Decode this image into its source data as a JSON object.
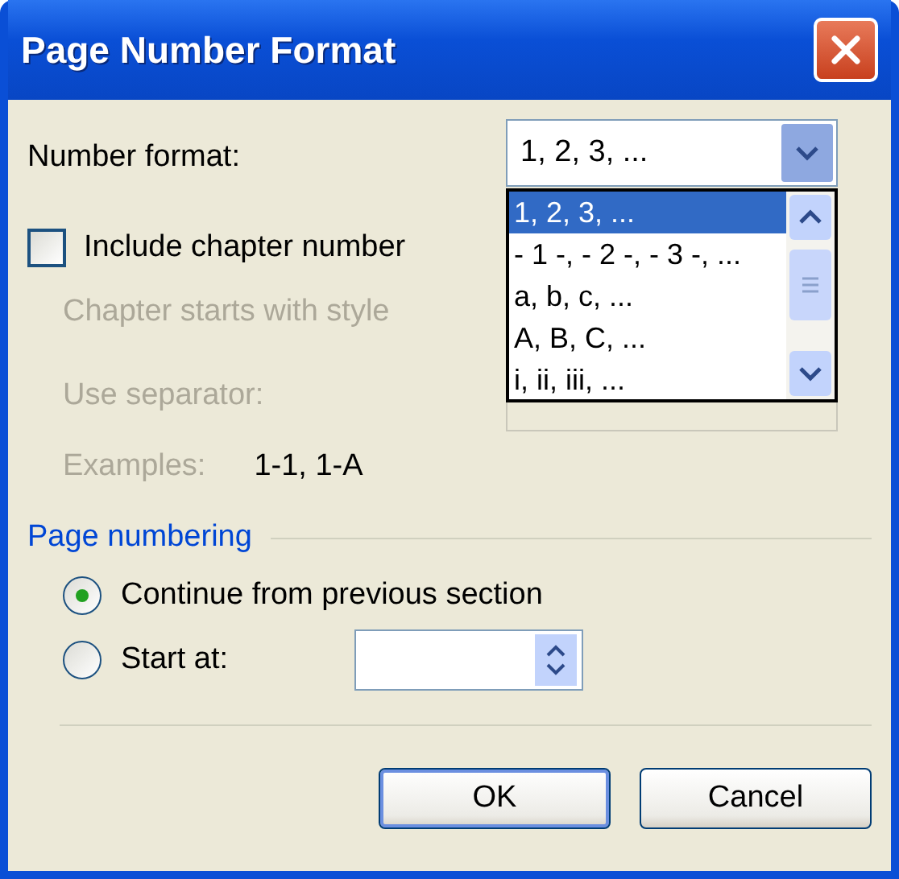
{
  "window": {
    "title": "Page Number Format"
  },
  "number_format": {
    "label": "Number format:",
    "value": "1, 2, 3, ...",
    "options": [
      {
        "label": "1, 2, 3, ...",
        "selected": true
      },
      {
        "label": "- 1 -, - 2 -, - 3 -, ...",
        "selected": false
      },
      {
        "label": "a, b, c, ...",
        "selected": false
      },
      {
        "label": "A, B, C, ...",
        "selected": false
      },
      {
        "label": "i, ii, iii, ...",
        "selected": false
      }
    ]
  },
  "include_chapter_number": {
    "label": "Include chapter number",
    "checked": false
  },
  "chapter_style": {
    "label": "Chapter starts with style",
    "disabled": true
  },
  "separator": {
    "label": "Use separator:",
    "disabled": true
  },
  "examples": {
    "label": "Examples:",
    "value": "1-1, 1-A",
    "disabled": true
  },
  "page_numbering": {
    "title": "Page numbering",
    "options": [
      {
        "label": "Continue from previous section",
        "selected": true
      },
      {
        "label": "Start at:",
        "selected": false
      }
    ]
  },
  "buttons": [
    {
      "label": "OK",
      "default": true
    },
    {
      "label": "Cancel",
      "default": false
    }
  ]
}
